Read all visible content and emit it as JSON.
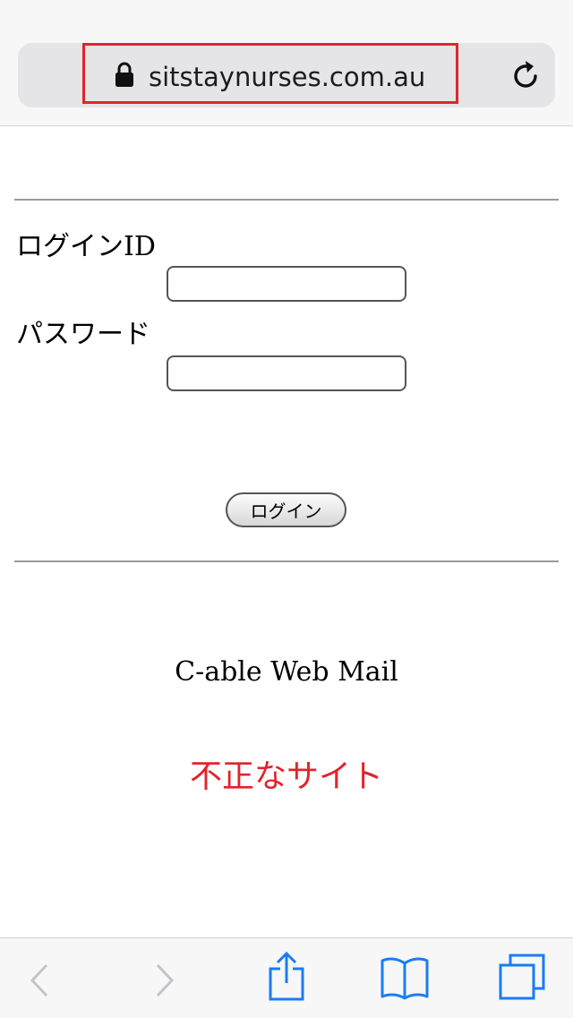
{
  "browser": {
    "url": "sitstaynurses.com.au",
    "icons": {
      "lock": "lock-icon",
      "reload": "reload-icon"
    },
    "highlight_color": "#e0242c"
  },
  "form": {
    "login_id_label": "ログインID",
    "login_id_value": "",
    "password_label": "パスワード",
    "password_value": "",
    "login_button_label": "ログイン"
  },
  "service_name": "C-able Web Mail",
  "warning_text": "不正なサイト",
  "warning_color": "#e0242c",
  "toolbar": {
    "icons": [
      "back-icon",
      "forward-icon",
      "share-icon",
      "bookmarks-icon",
      "tabs-icon"
    ],
    "accent_color": "#1a7cf4",
    "disabled_color": "#c4c4c8"
  }
}
